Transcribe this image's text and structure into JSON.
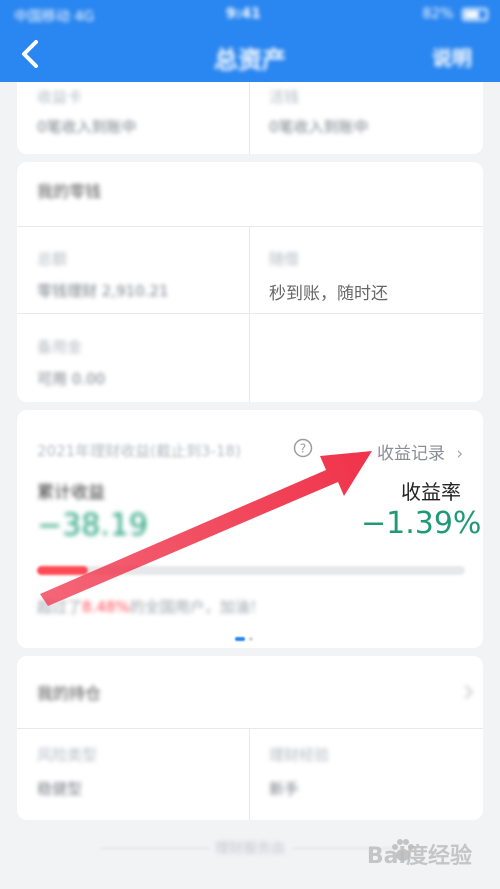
{
  "status_bar": {
    "carrier": "中国移动 4G",
    "time": "9:41",
    "battery": "82%"
  },
  "header": {
    "title": "总资产",
    "action": "说明"
  },
  "account_card": {
    "cells": [
      {
        "label": "收益卡",
        "value": "0笔收入到账中"
      },
      {
        "label": "活钱",
        "value": "0笔收入到账中"
      }
    ]
  },
  "balance_card": {
    "title": "我的零钱",
    "cells": [
      {
        "label": "总额",
        "value": "零钱理财 2,910.21"
      },
      {
        "label": "随借",
        "value": "秒到账，随时还"
      },
      {
        "label": "备用金",
        "value": "可用 0.00"
      }
    ]
  },
  "earnings_card": {
    "title": "2021年理财收益(截止到3-18)",
    "record_link": "收益记录",
    "cumulative_label": "累计收益",
    "cumulative_value": "−38.19",
    "rate_label": "收益率",
    "rate_value": "−1.39%",
    "progress": 0.12,
    "rank_prefix": "超过了",
    "rank_highlight": "8.48%",
    "rank_suffix": "的全国用户，加油！"
  },
  "position_card": {
    "title": "我的持仓",
    "cells": [
      {
        "label": "风险类型",
        "value": "稳健型"
      },
      {
        "label": "理财经验",
        "value": "新手"
      }
    ]
  },
  "footer": {
    "text": "理财服务由"
  },
  "watermark": {
    "text": "Bai度经验"
  },
  "colors": {
    "header_bg": "#2a86f0",
    "loss_green": "#1f9a74",
    "arrow_red": "#f0334a",
    "progress_red": "#ff4a55"
  }
}
